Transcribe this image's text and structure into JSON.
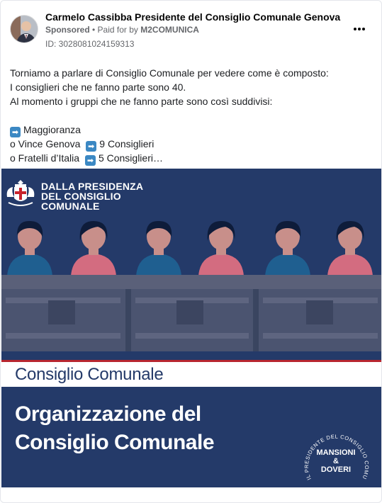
{
  "post": {
    "page_name": "Carmelo Cassibba Presidente del Consiglio Comunale Genova",
    "sponsored_label": "Sponsored",
    "paid_for_prefix": " • Paid for by ",
    "advertiser": "M2COMUNICA",
    "ad_id": "ID: 3028081024159313",
    "more_icon": "more-options-icon",
    "text": {
      "line1": "Torniamo a parlare di Consiglio Comunale per vedere come è composto:",
      "line2": "I consiglieri che ne fanno parte sono 40.",
      "line3": "Al momento i gruppi che ne fanno parte sono così suddivisi:",
      "line4": "Maggioranza",
      "line5a": "o Vince Genova",
      "line5b": "9 Consiglieri",
      "line6a": "o Fratelli d’Italia",
      "line6b": "5 Consiglieri…"
    },
    "arrow_glyph": "➡"
  },
  "creative": {
    "header_lines": [
      "DALLA PRESIDENZA",
      "DEL CONSIGLIO",
      "COMUNALE"
    ],
    "band_text": "Consiglio Comunale",
    "title_lines": [
      "Organizzazione del",
      "Consiglio Comunale"
    ],
    "badge_ring_text": "IL PRESIDENTE DEL CONSIGLIO COMUNALE",
    "badge_lines": [
      "MANSIONI",
      "&",
      "DOVERI"
    ],
    "colors": {
      "navy": "#243a69",
      "accent_red": "#b8262f",
      "white": "#ffffff",
      "figure_blue": "#1f5f90",
      "figure_pink": "#d36c80"
    }
  }
}
